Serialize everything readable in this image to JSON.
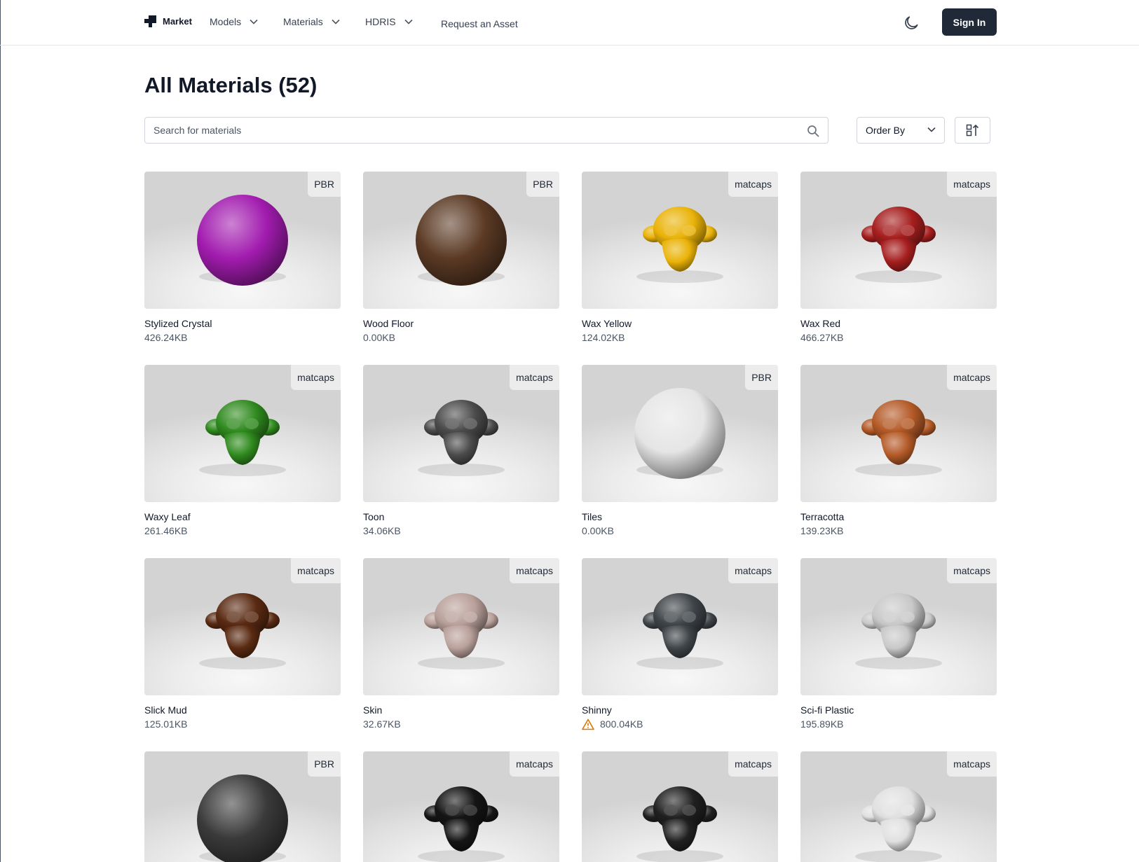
{
  "header": {
    "logo_label": "Market",
    "nav": [
      {
        "label": "Models"
      },
      {
        "label": "Materials"
      },
      {
        "label": "HDRIS"
      }
    ],
    "request_link": "Request an Asset",
    "theme_icon": "moon-icon",
    "signin_label": "Sign In"
  },
  "page": {
    "title": "All Materials (52)",
    "search_placeholder": "Search for materials",
    "order_by_label": "Order By"
  },
  "materials": [
    {
      "name": "Stylized Crystal",
      "size": "426.24KB",
      "tag": "PBR",
      "color": "#a21caf",
      "shape": "sphere"
    },
    {
      "name": "Wood Floor",
      "size": "0.00KB",
      "tag": "PBR",
      "color": "#5b3a24",
      "shape": "sphere"
    },
    {
      "name": "Wax Yellow",
      "size": "124.02KB",
      "tag": "matcaps",
      "color": "#eab308",
      "shape": "monkey"
    },
    {
      "name": "Wax Red",
      "size": "466.27KB",
      "tag": "matcaps",
      "color": "#a61e1e",
      "shape": "monkey"
    },
    {
      "name": "Waxy Leaf",
      "size": "261.46KB",
      "tag": "matcaps",
      "color": "#2f8a1e",
      "shape": "monkey"
    },
    {
      "name": "Toon",
      "size": "34.06KB",
      "tag": "matcaps",
      "color": "#4b4b4b",
      "shape": "monkey"
    },
    {
      "name": "Tiles",
      "size": "0.00KB",
      "tag": "PBR",
      "color": "#e5e5e5",
      "shape": "sphere"
    },
    {
      "name": "Terracotta",
      "size": "139.23KB",
      "tag": "matcaps",
      "color": "#b45a27",
      "shape": "monkey"
    },
    {
      "name": "Slick Mud",
      "size": "125.01KB",
      "tag": "matcaps",
      "color": "#5a2a12",
      "shape": "monkey"
    },
    {
      "name": "Skin",
      "size": "32.67KB",
      "tag": "matcaps",
      "color": "#b9a09a",
      "shape": "monkey"
    },
    {
      "name": "Shinny",
      "size": "800.04KB",
      "tag": "matcaps",
      "color": "#3f4448",
      "shape": "monkey",
      "warning": true
    },
    {
      "name": "Sci-fi Plastic",
      "size": "195.89KB",
      "tag": "matcaps",
      "color": "#c8c8c8",
      "shape": "monkey"
    },
    {
      "name": "",
      "size": "",
      "tag": "PBR",
      "color": "#3a3a3a",
      "shape": "sphere"
    },
    {
      "name": "",
      "size": "",
      "tag": "matcaps",
      "color": "#151515",
      "shape": "monkey"
    },
    {
      "name": "",
      "size": "",
      "tag": "matcaps",
      "color": "#202020",
      "shape": "monkey"
    },
    {
      "name": "",
      "size": "",
      "tag": "matcaps",
      "color": "#e0e0e0",
      "shape": "monkey"
    }
  ],
  "colors": {
    "signin_bg": "#1f2937",
    "warning": "#d97706"
  }
}
